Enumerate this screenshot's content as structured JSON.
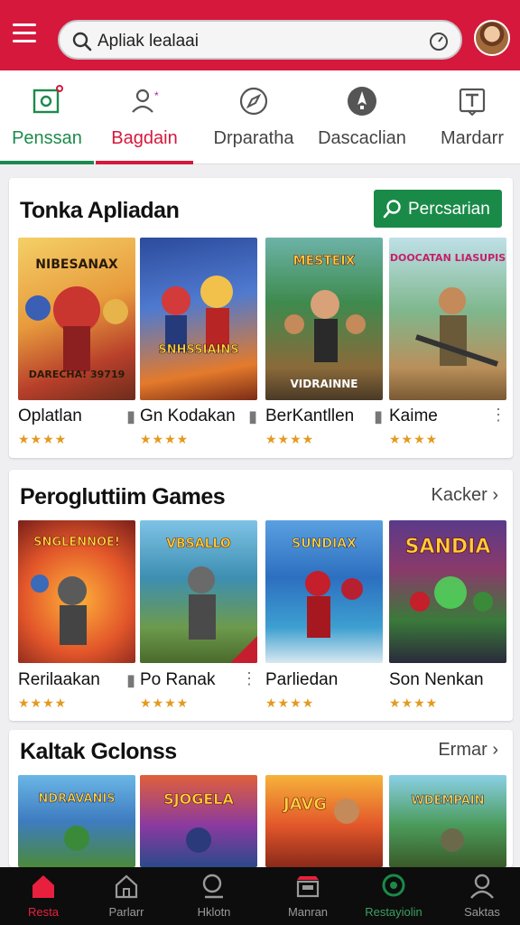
{
  "search": {
    "text": "Apliak lealaai"
  },
  "tabs": [
    {
      "label": "Penssan"
    },
    {
      "label": "Bagdain"
    },
    {
      "label": "Drparatha"
    },
    {
      "label": "Dascaclian"
    },
    {
      "label": "Mardarr"
    }
  ],
  "section1": {
    "title": "Tonka Apliadan",
    "button_label": "Percsarian",
    "apps": [
      {
        "name": "Oplatlan",
        "art_text": "NIBESANAX",
        "art_sub": "DARECHA! 39719",
        "rating": "★★★★"
      },
      {
        "name": "Gn Kodakan",
        "art_text": "SNHSSIAINS",
        "art_sub": "",
        "rating": "★★★★"
      },
      {
        "name": "BerKantllen",
        "art_text": "MESTEIX",
        "art_sub": "VIDRAINNE",
        "rating": "★★★★"
      },
      {
        "name": "Kaime",
        "art_text": "DOOCATAN LIASUPIS",
        "art_sub": "",
        "rating": "★★★★"
      }
    ]
  },
  "section2": {
    "title": "Perogluttiim Games",
    "more_label": "Kacker",
    "apps": [
      {
        "name": "Rerilaakan",
        "art_text": "SNGLENNOE!",
        "rating": "★★★★"
      },
      {
        "name": "Po Ranak",
        "art_text": "VBSALLO",
        "rating": "★★★★"
      },
      {
        "name": "Parliedan",
        "art_text": "SUNDIAX",
        "rating": "★★★★"
      },
      {
        "name": "Son Nenkan",
        "art_text": "SANDIA",
        "rating": "★★★★"
      }
    ]
  },
  "section3": {
    "title": "Kaltak Gclonss",
    "more_label": "Ermar",
    "apps": [
      {
        "art_text": "NDRAVANIS"
      },
      {
        "art_text": "SJOGELA"
      },
      {
        "art_text": "JAVG"
      },
      {
        "art_text": "WDEMPAIN"
      }
    ]
  },
  "bottom_nav": [
    {
      "label": "Resta"
    },
    {
      "label": "Parlarr"
    },
    {
      "label": "Hklotn"
    },
    {
      "label": "Manran"
    },
    {
      "label": "Restayiolin"
    },
    {
      "label": "Saktas"
    }
  ],
  "colors": {
    "brand_red": "#d6183d",
    "brand_green": "#1a8a48",
    "star": "#e39a1f"
  }
}
